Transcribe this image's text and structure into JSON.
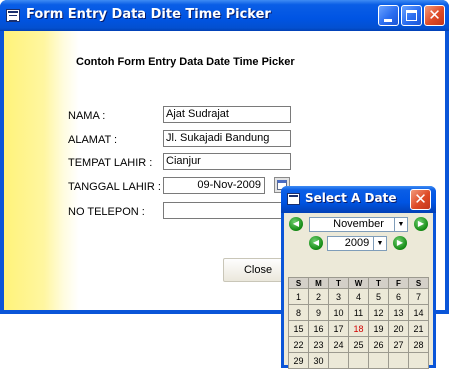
{
  "window": {
    "title": "Form Entry Data Dite Time Picker"
  },
  "form": {
    "heading": "Contoh Form Entry Data Date Time Picker",
    "fields": [
      {
        "label": "NAMA :",
        "value": "Ajat Sudrajat"
      },
      {
        "label": "ALAMAT :",
        "value": "Jl. Sukajadi Bandung"
      },
      {
        "label": "TEMPAT LAHIR :",
        "value": "Cianjur"
      },
      {
        "label": "TANGGAL LAHIR :",
        "value": "09-Nov-2009"
      },
      {
        "label": "NO TELEPON :",
        "value": ""
      }
    ],
    "close_label": "Close"
  },
  "picker": {
    "title": "Select A Date",
    "month": "November",
    "year": "2009",
    "selected_day": 18,
    "weekdays": [
      "S",
      "M",
      "T",
      "W",
      "T",
      "F",
      "S"
    ],
    "weeks": [
      [
        "1",
        "2",
        "3",
        "4",
        "5",
        "6",
        "7"
      ],
      [
        "8",
        "9",
        "10",
        "11",
        "12",
        "13",
        "14"
      ],
      [
        "15",
        "16",
        "17",
        "18",
        "19",
        "20",
        "21"
      ],
      [
        "22",
        "23",
        "24",
        "25",
        "26",
        "27",
        "28"
      ],
      [
        "29",
        "30",
        "",
        "",
        "",
        "",
        ""
      ],
      [
        "",
        "",
        "",
        "",
        "",
        "",
        ""
      ]
    ],
    "colors": {
      "today": "#d00000",
      "nav_green": "#138a13"
    }
  }
}
